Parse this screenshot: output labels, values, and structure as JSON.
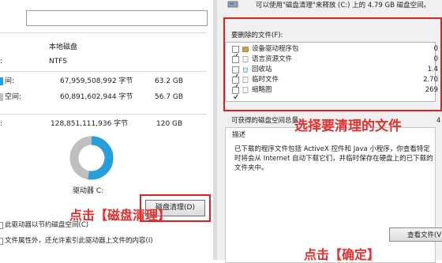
{
  "left": {
    "label_local_disk": "本地磁盘",
    "label_fs_value": "NTFS",
    "rows": [
      {
        "label": "间:",
        "bytes": "67,959,508,992 字节",
        "size": "63.2 GB"
      },
      {
        "label": "空间:",
        "bytes": "60,891,602,944 字节",
        "size": "56.7 GB"
      },
      {
        "label": ":",
        "bytes": "128,851,111,936 字节",
        "size": "120 GB"
      }
    ],
    "fs_prefix": ":",
    "drive_label": "驱动器 C:",
    "clean_button": "磁盘清理(D)",
    "annotation": "点击【磁盘清理】",
    "checkbox1": "此驱动器以节约磁盘空间(C)",
    "checkbox2": "文件属性外，还允许索引此驱动器上文件的内容(I)",
    "colors": {
      "used": "#26a0da",
      "free": "#bfbfbf"
    }
  },
  "right": {
    "header": "可以使用\"磁盘清理\"来释放 (C:) 上的 4.79 GB 磁盘空间。",
    "files_label": "要删除的文件(F):",
    "files": [
      {
        "name": "设备驱动程序包",
        "size": "0",
        "checked": true,
        "icon": "package-icon"
      },
      {
        "name": "语言资源文件",
        "size": "0",
        "checked": false,
        "icon": "file-icon"
      },
      {
        "name": "回收站",
        "size": "1.4",
        "checked": true,
        "icon": "recycle-bin-icon"
      },
      {
        "name": "临时文件",
        "size": "2.70",
        "checked": true,
        "icon": "file-icon"
      },
      {
        "name": "缩略图",
        "size": "269",
        "checked": true,
        "icon": "file-icon"
      }
    ],
    "available_label": "可获得的磁盘空间总量:",
    "available_value": "4",
    "annotation_top": "选择要清理的文件",
    "desc_label": "描述",
    "desc_text_1": "已下载的程序文件包括 ActiveX 控件和 Java 小程序，你查看特定",
    "desc_text_2": "时将会从 Internet 自动下载它们，并临时保存在硬盘上的已下载的",
    "desc_text_3": "文件夹中。",
    "view_button": "查看文件(V",
    "annotation_bottom": "点击【确定】"
  }
}
